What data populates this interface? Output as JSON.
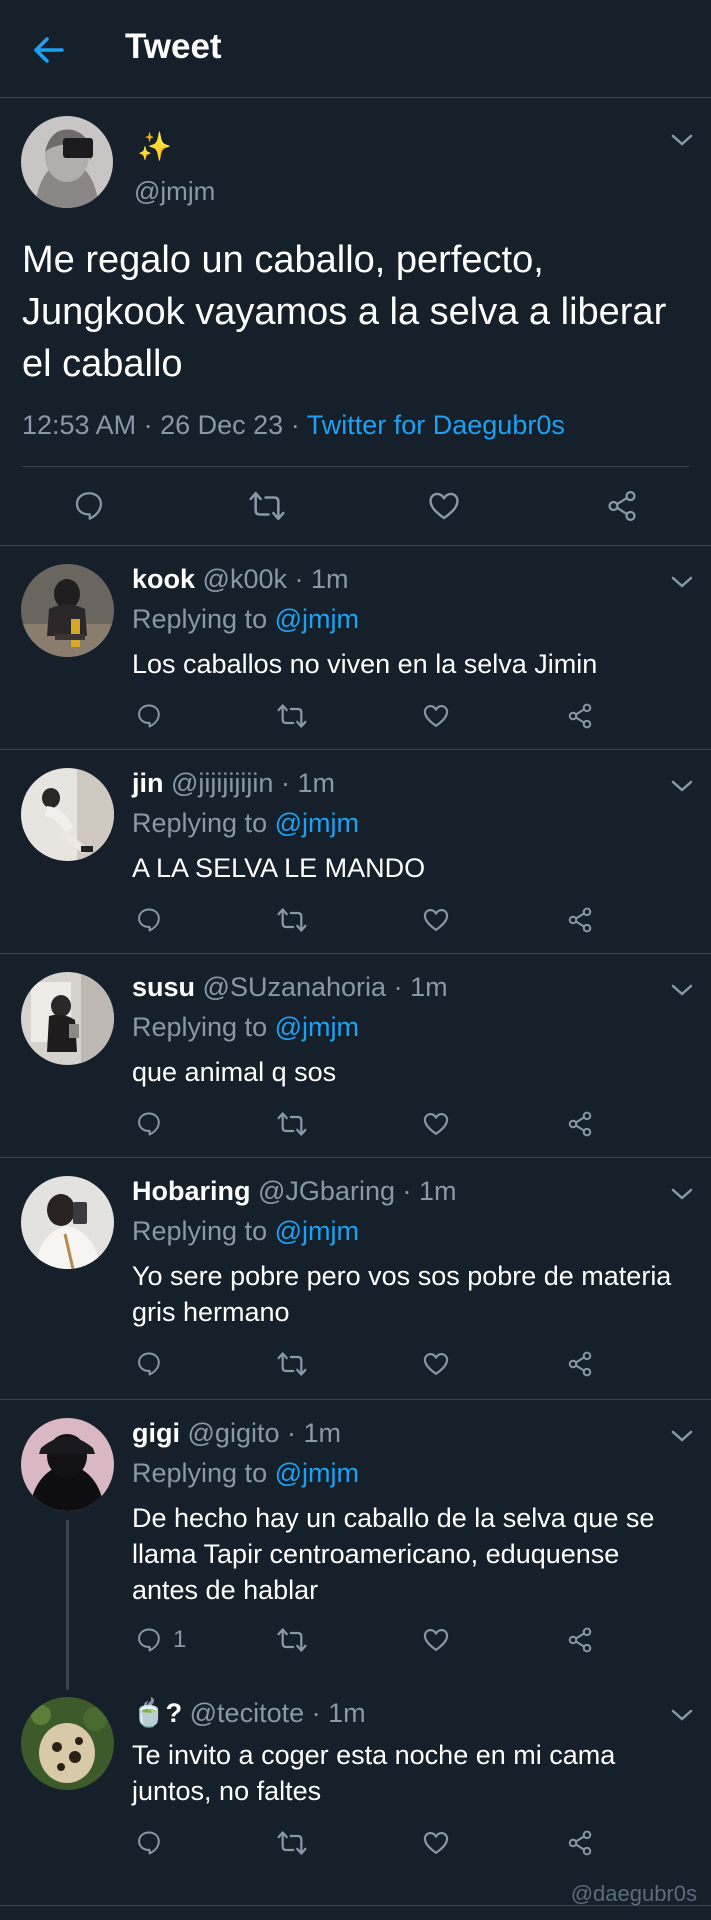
{
  "header": {
    "title": "Tweet",
    "back_icon": "arrow-left-icon"
  },
  "main_tweet": {
    "name": "✨",
    "handle": "@jmjm",
    "text": "Me regalo un caballo, perfecto, Jungkook vayamos a la selva a liberar el caballo",
    "time": "12:53 AM",
    "date": "26 Dec 23",
    "source": "Twitter for Daegubr0s",
    "separator": "·"
  },
  "replies": [
    {
      "name": "kook",
      "handle": "@k00k",
      "time": "1m",
      "replying_label": "Replying to",
      "replying_to": "@jmjm",
      "text": "Los caballos no viven en la selva Jimin",
      "reply_count": ""
    },
    {
      "name": "jin",
      "handle": "@jijijijijin",
      "time": "1m",
      "replying_label": "Replying to",
      "replying_to": "@jmjm",
      "text": "A LA SELVA LE MANDO",
      "reply_count": ""
    },
    {
      "name": "susu",
      "handle": "@SUzanahoria",
      "time": "1m",
      "replying_label": "Replying to",
      "replying_to": "@jmjm",
      "text": "que animal q sos",
      "reply_count": ""
    },
    {
      "name": "Hobaring",
      "handle": "@JGbaring",
      "time": "1m",
      "replying_label": "Replying to",
      "replying_to": "@jmjm",
      "text": "Yo sere pobre pero vos sos pobre de materia gris hermano",
      "reply_count": ""
    },
    {
      "name": "gigi",
      "handle": "@gigito",
      "time": "1m",
      "replying_label": "Replying to",
      "replying_to": "@jmjm",
      "text": "De hecho hay un caballo de la selva que se llama Tapir centroamericano, eduquense antes de hablar",
      "reply_count": "1"
    },
    {
      "name": "🍵?",
      "handle": "@tecitote",
      "time": "1m",
      "text": "Te invito a coger esta noche en mi cama juntos, no faltes",
      "reply_count": ""
    }
  ],
  "watermark": "@daegubr0s",
  "colors": {
    "background": "#15202b",
    "accent": "#1da1f2",
    "muted": "#8899a6",
    "divider": "#38444d"
  }
}
